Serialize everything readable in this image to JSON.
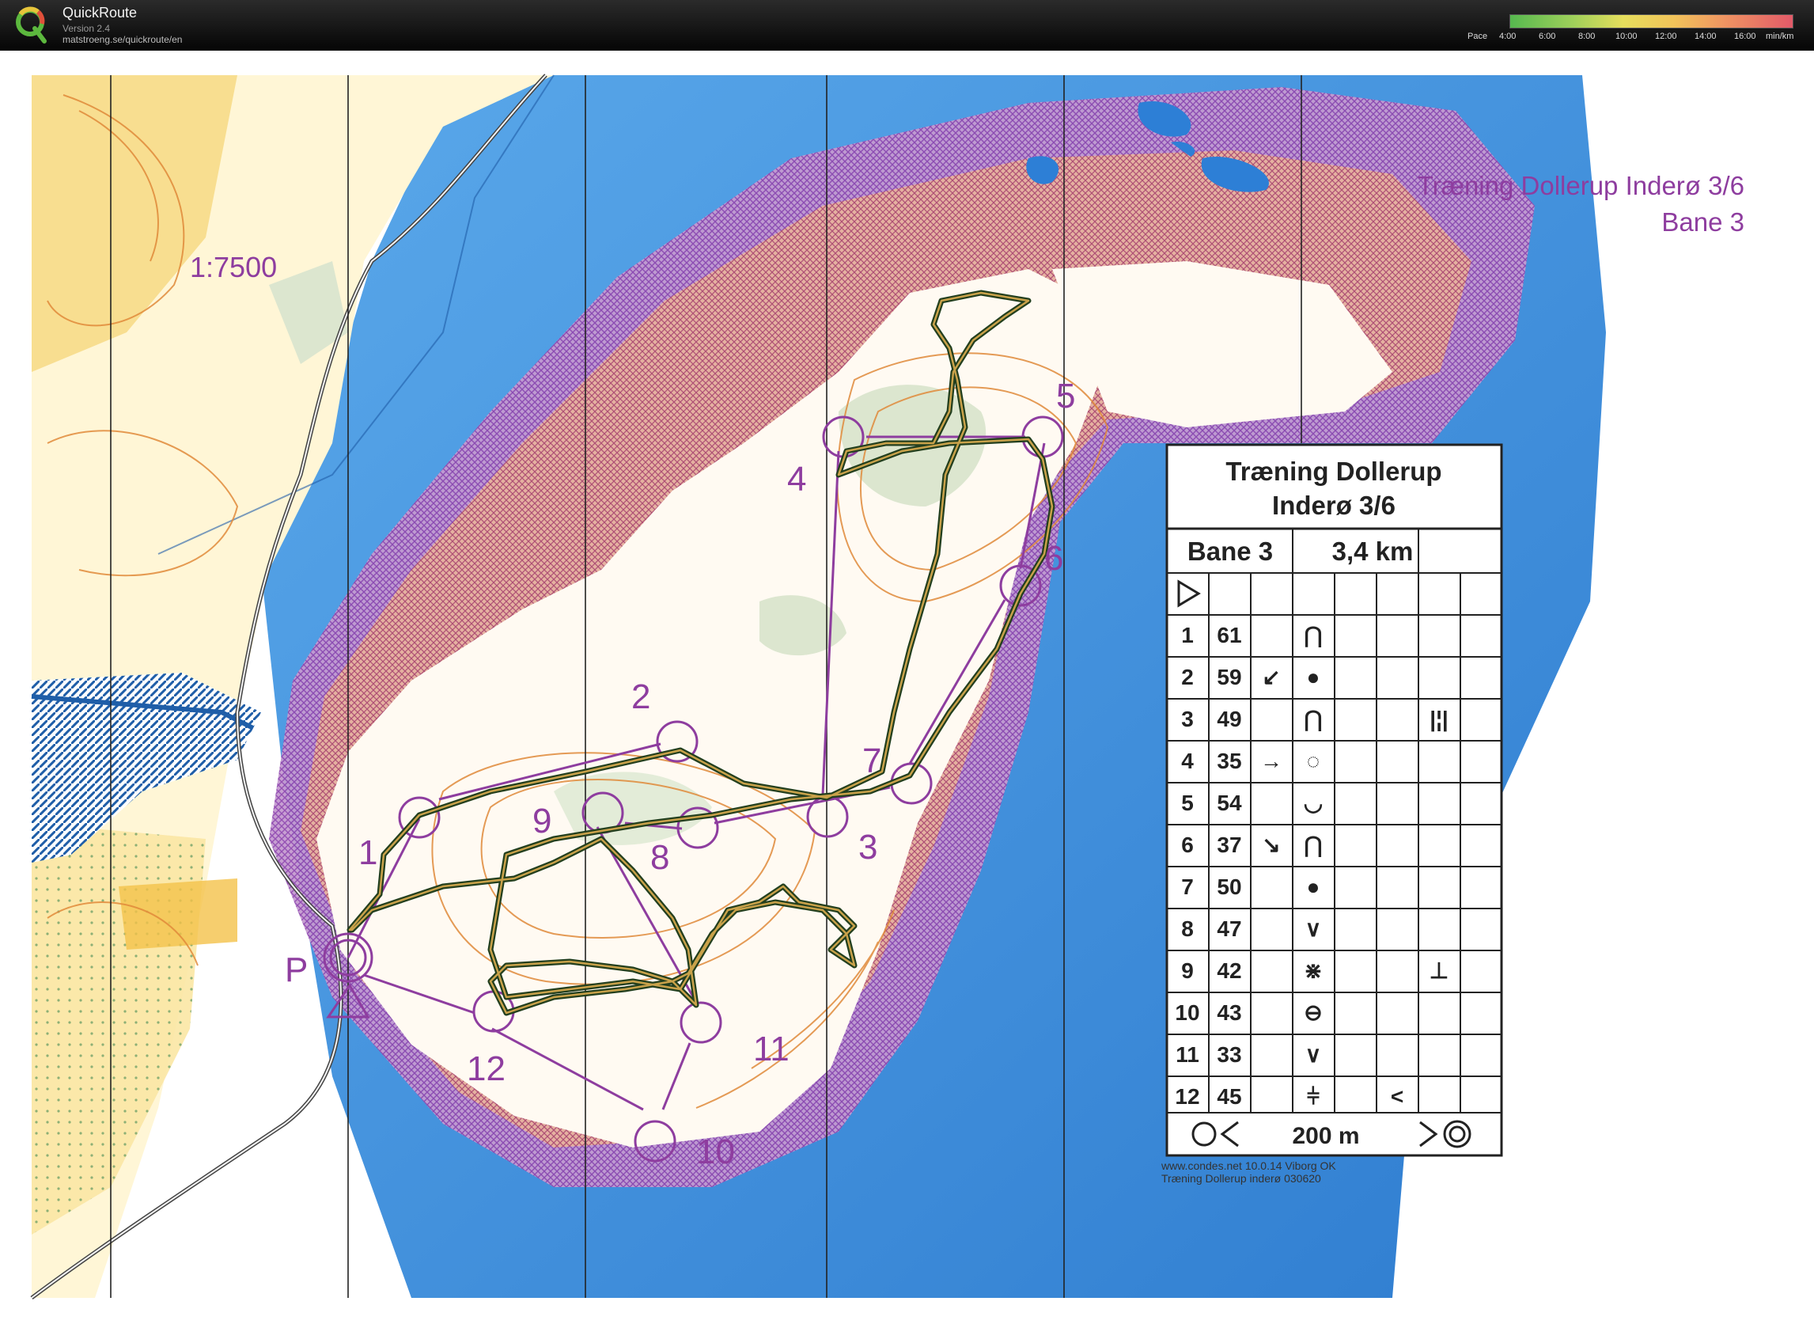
{
  "app": {
    "name": "QuickRoute",
    "version": "Version 2.4",
    "url": "matstroeng.se/quickroute/en"
  },
  "pace_legend": {
    "label": "Pace",
    "ticks": [
      "4:00",
      "6:00",
      "8:00",
      "10:00",
      "12:00",
      "14:00",
      "16:00"
    ],
    "unit": "min/km"
  },
  "map": {
    "scale": "1:7500",
    "title_line1": "Træning Dollerup Inderø 3/6",
    "title_line2": "Bane 3",
    "parking": "P",
    "controls": [
      "1",
      "2",
      "3",
      "4",
      "5",
      "6",
      "7",
      "8",
      "9",
      "10",
      "11",
      "12"
    ],
    "colors": {
      "water": "#2d7fd6",
      "course": "#8e3d9f",
      "contour": "#e08a3a",
      "open_land": "#f5d46a",
      "out_of_bounds": "#8f48b0",
      "route": "#2e5a2a"
    }
  },
  "description": {
    "title_line1": "Træning Dollerup",
    "title_line2": "Inderø 3/6",
    "course": "Bane 3",
    "length": "3,4 km",
    "rows": [
      {
        "n": "1",
        "code": "61",
        "dir": "",
        "feature": "⋂",
        "extra": ""
      },
      {
        "n": "2",
        "code": "59",
        "dir": "↙",
        "feature": "●",
        "extra": ""
      },
      {
        "n": "3",
        "code": "49",
        "dir": "",
        "feature": "⋂",
        "extra": "|¦|"
      },
      {
        "n": "4",
        "code": "35",
        "dir": "→",
        "feature": "◌",
        "extra": ""
      },
      {
        "n": "5",
        "code": "54",
        "dir": "",
        "feature": "◡",
        "extra": ""
      },
      {
        "n": "6",
        "code": "37",
        "dir": "↘",
        "feature": "⋂",
        "extra": ""
      },
      {
        "n": "7",
        "code": "50",
        "dir": "",
        "feature": "●",
        "extra": ""
      },
      {
        "n": "8",
        "code": "47",
        "dir": "",
        "feature": "∨",
        "extra": ""
      },
      {
        "n": "9",
        "code": "42",
        "dir": "",
        "feature": "⋇",
        "extra": "⊥"
      },
      {
        "n": "10",
        "code": "43",
        "dir": "",
        "feature": "⊖",
        "extra": ""
      },
      {
        "n": "11",
        "code": "33",
        "dir": "",
        "feature": "∨",
        "extra": ""
      },
      {
        "n": "12",
        "code": "45",
        "dir": "",
        "feature": "⫩",
        "extra": "<"
      }
    ],
    "finish": "200 m",
    "footer_line1": "www.condes.net 10.0.14 Viborg OK",
    "footer_line2": "Træning Dollerup inderø 030620"
  }
}
